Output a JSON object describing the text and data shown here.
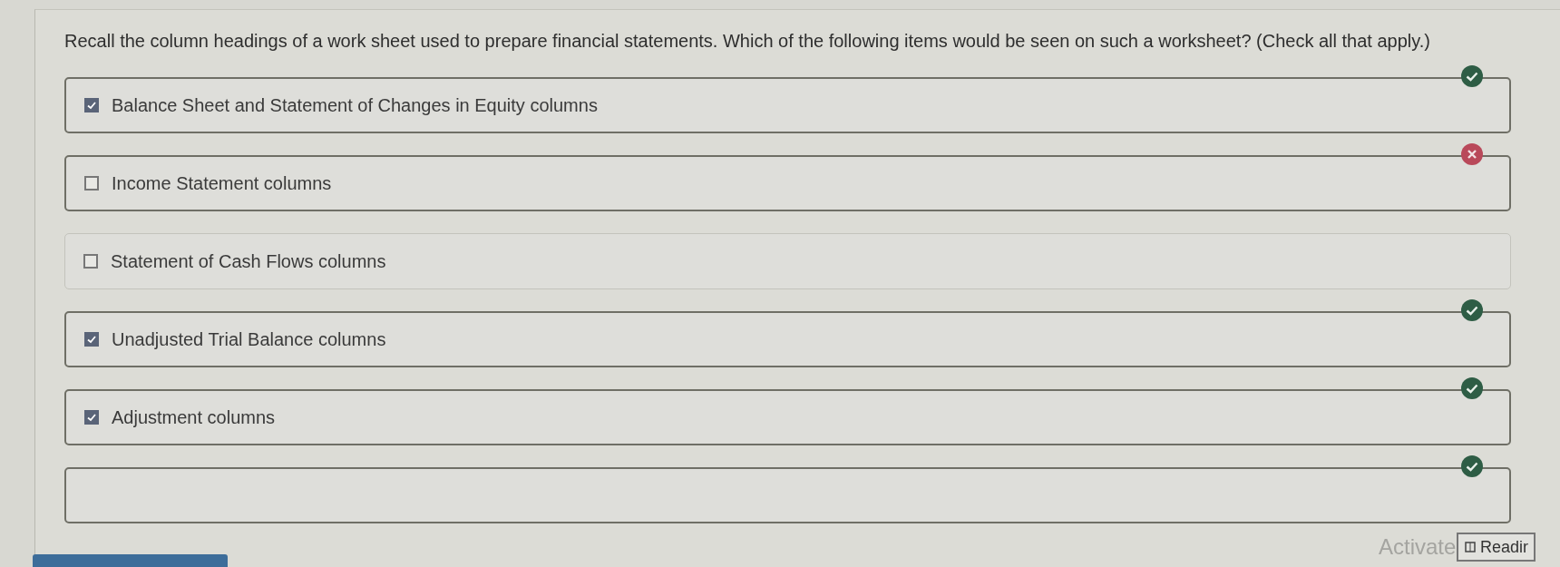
{
  "question": "Recall the column headings of a work sheet used to prepare financial statements. Which of the following items would be seen on such a worksheet? (Check all that apply.)",
  "options": [
    {
      "label": "Balance Sheet and Statement of Changes in Equity columns",
      "checked": true,
      "marked": true,
      "correct": true
    },
    {
      "label": "Income Statement columns",
      "checked": false,
      "marked": true,
      "correct": false
    },
    {
      "label": "Statement of Cash Flows columns",
      "checked": false,
      "marked": false
    },
    {
      "label": "Unadjusted Trial Balance columns",
      "checked": true,
      "marked": true,
      "correct": true
    },
    {
      "label": "Adjustment columns",
      "checked": true,
      "marked": true,
      "correct": true
    },
    {
      "marked": true,
      "correct": true
    }
  ],
  "overlay_text": "Activate",
  "reading_button": "Readir"
}
